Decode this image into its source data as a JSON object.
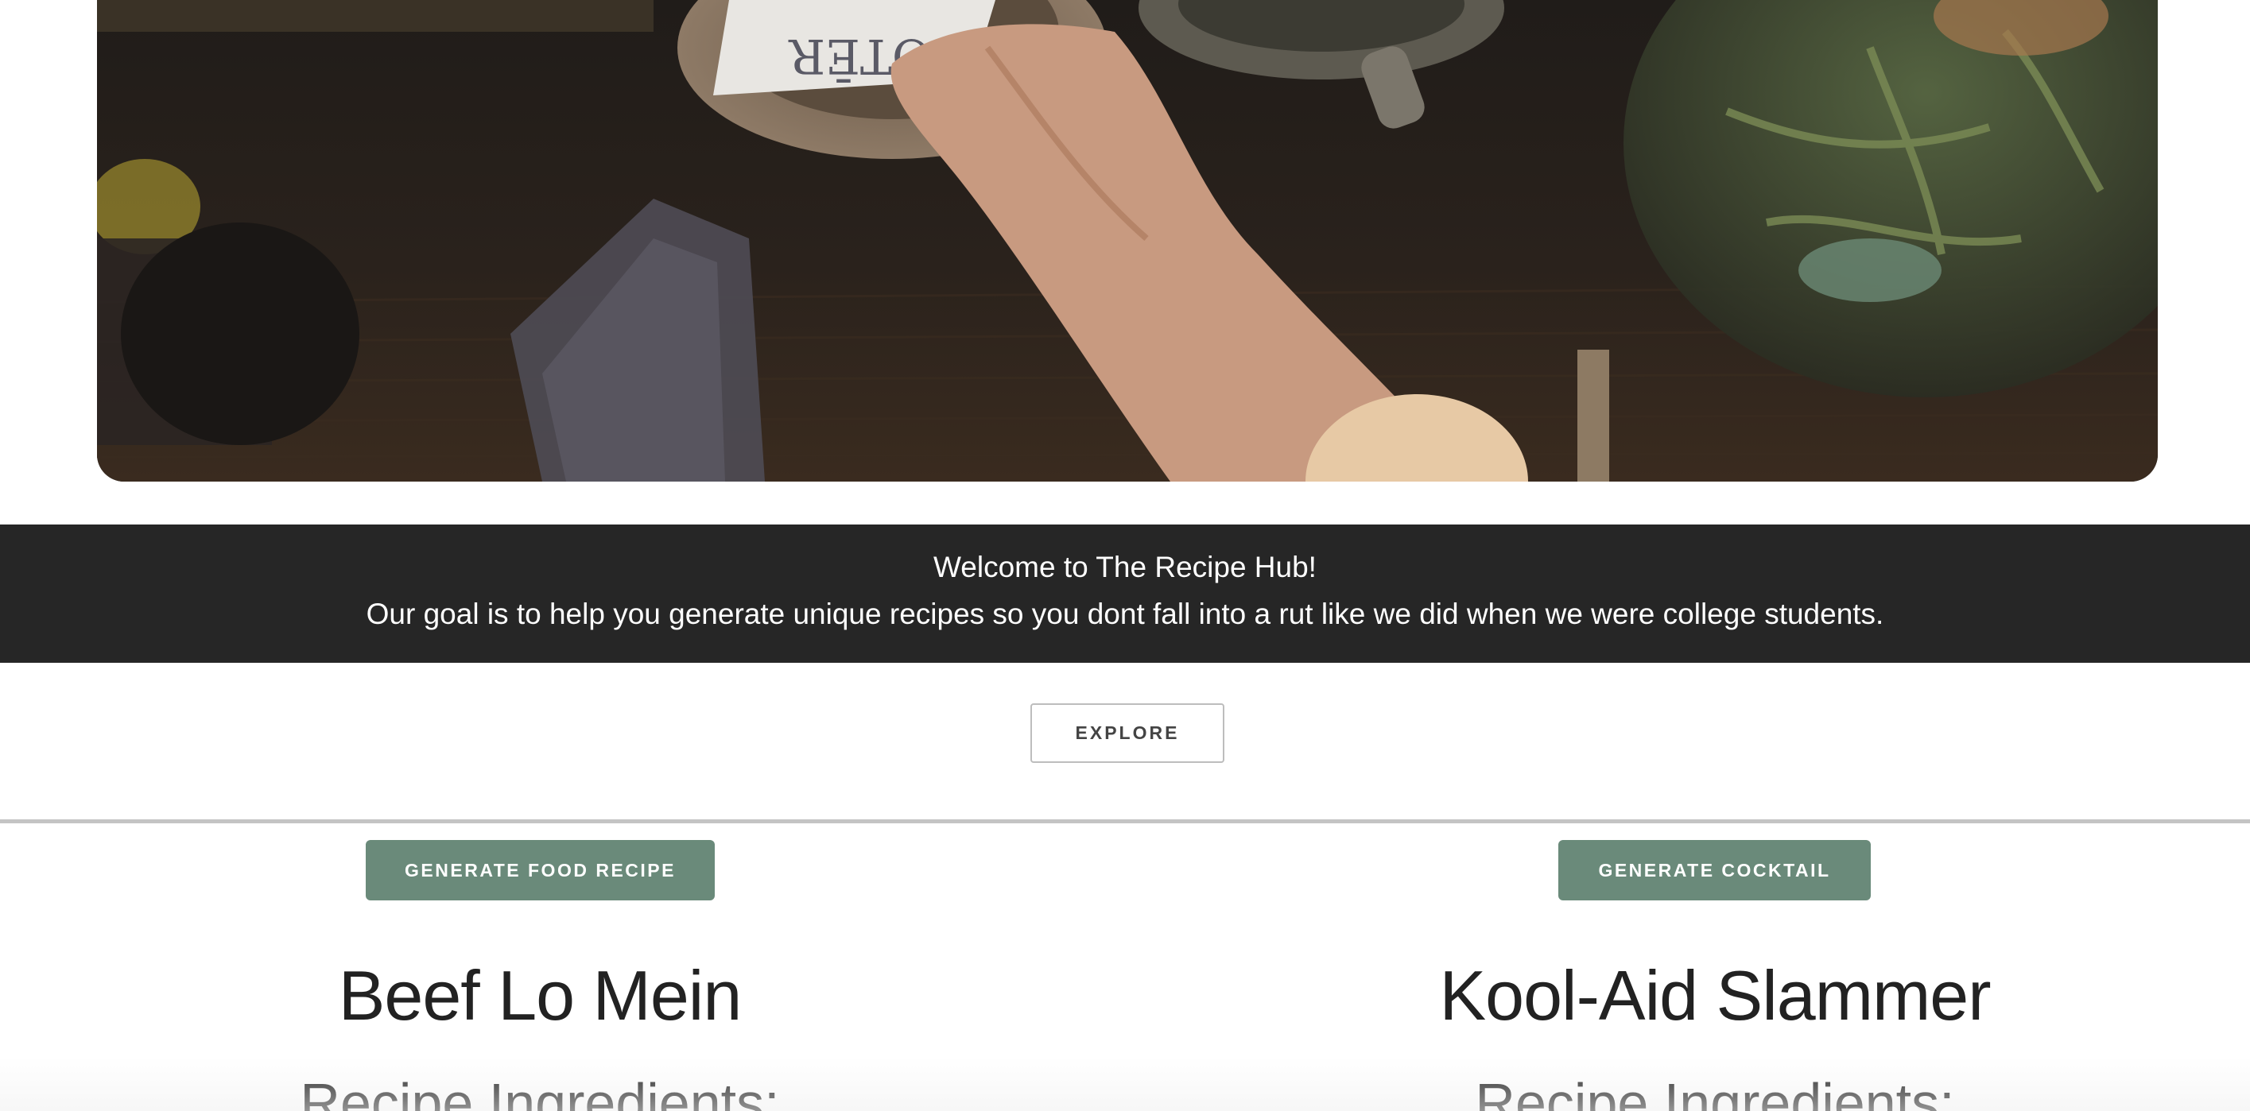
{
  "hero": {
    "image_name": "dinner-table-photo",
    "card_text": "OTĒR"
  },
  "banner": {
    "welcome": "Welcome to The Recipe Hub!",
    "goal": "Our goal is to help you generate unique recipes so you dont fall into a rut like we did when we were college students."
  },
  "explore_button": "EXPLORE",
  "food": {
    "button": "GENERATE FOOD RECIPE",
    "title": "Beef Lo Mein",
    "ingredients_heading": "Recipe Ingredients:"
  },
  "cocktail": {
    "button": "GENERATE COCKTAIL",
    "title": "Kool-Aid Slammer",
    "ingredients_heading": "Recipe Ingredients:"
  },
  "colors": {
    "banner_bg": "#262626",
    "button_green": "#6a8a7a",
    "divider": "#c4c4c4"
  }
}
